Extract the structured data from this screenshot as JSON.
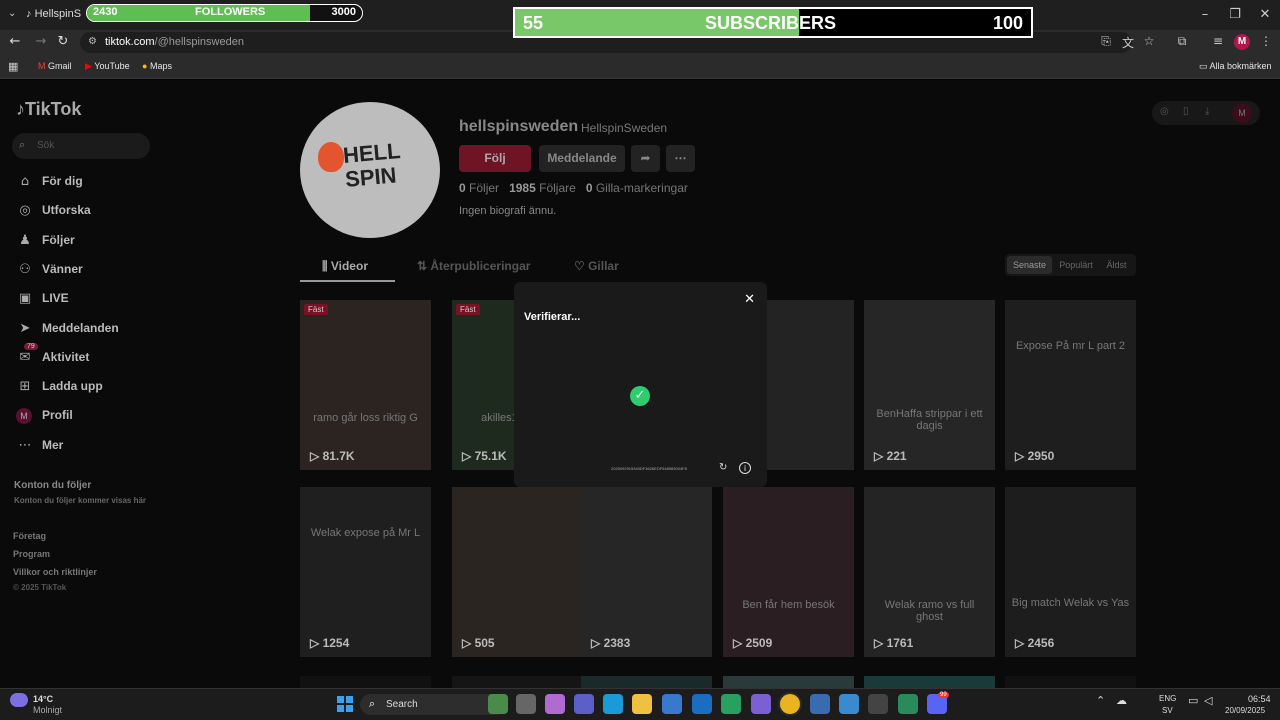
{
  "browser": {
    "tab_title": "HellspinS",
    "url_domain": "tiktok.com",
    "url_path": "/@hellspinsweden",
    "bookmarks": [
      "Gmail",
      "YouTube",
      "Maps"
    ],
    "all_bookmarks": "Alla bokmärken",
    "profile_initial": "M"
  },
  "followers_bar": {
    "current": "2430",
    "label": "FOLLOWERS",
    "goal": "3000",
    "progress": 0.81,
    "color": "#5fbe52"
  },
  "subscribers_bar": {
    "current": "55",
    "label": "SUBSCRIBERS",
    "goal": "100",
    "progress": 0.55,
    "color": "#78c86a"
  },
  "tiktok": {
    "logo": "TikTok",
    "search_placeholder": "Sök",
    "nav": [
      {
        "label": "För dig",
        "icon": "home-icon"
      },
      {
        "label": "Utforska",
        "icon": "compass-icon"
      },
      {
        "label": "Följer",
        "icon": "person-icon"
      },
      {
        "label": "Vänner",
        "icon": "friends-icon"
      },
      {
        "label": "LIVE",
        "icon": "live-icon"
      },
      {
        "label": "Meddelanden",
        "icon": "send-icon"
      },
      {
        "label": "Aktivitet",
        "icon": "bell-icon",
        "badge": "79"
      },
      {
        "label": "Ladda upp",
        "icon": "plus-icon"
      },
      {
        "label": "Profil",
        "icon": "avatar-icon"
      },
      {
        "label": "Mer",
        "icon": "more-icon"
      }
    ],
    "following_title": "Konton du följer",
    "following_sub": "Konton du följer kommer visas här",
    "footer": [
      "Företag",
      "Program",
      "Villkor och riktlinjer",
      "© 2025 TikTok"
    ],
    "profile": {
      "username": "hellspinsweden",
      "nickname": "HellspinSweden",
      "follow": "Följ",
      "message": "Meddelande",
      "following_count": "0",
      "following_label": "Följer",
      "followers_count": "1985",
      "followers_label": "Följare",
      "likes_count": "0",
      "likes_label": "Gilla-markeringar",
      "bio": "Ingen biografi ännu.",
      "logo_text": "HELL SPIN"
    },
    "tabs": [
      "Videor",
      "Återpubliceringar",
      "Gillar"
    ],
    "sort": [
      "Senaste",
      "Populärt",
      "Äldst"
    ],
    "videos_row1": [
      {
        "caption": "ramo går loss riktig G",
        "views": "81.7K",
        "pinned": "Fäst"
      },
      {
        "caption": "akilles1 går los",
        "views": "75.1K",
        "pinned": "Fäst"
      },
      {
        "caption": "",
        "views": ""
      },
      {
        "caption": "",
        "views": ""
      },
      {
        "caption": "BenHaffa strippar i ett dagis",
        "views": "221"
      },
      {
        "caption": "Expose På mr L part 2",
        "views": "2950"
      }
    ],
    "videos_row2": [
      {
        "caption": "Welak expose på Mr L",
        "views": "1254"
      },
      {
        "caption": "",
        "views": "505"
      },
      {
        "caption": "",
        "views": "2383"
      },
      {
        "caption": "Ben får hem besök",
        "views": "2509"
      },
      {
        "caption": "Welak ramo vs full ghost",
        "views": "1761"
      },
      {
        "caption": "Big match Welak vs Yas",
        "views": "2456"
      }
    ]
  },
  "modal": {
    "title": "Verifierar...",
    "token": "2025092915340DF3626EDF548983004F8"
  },
  "taskbar": {
    "temp": "14°C",
    "weather": "Molnigt",
    "search": "Search",
    "lang1": "ENG",
    "lang2": "SV",
    "time": "06:54",
    "date": "20/09/2025",
    "discord_badge": "99"
  }
}
